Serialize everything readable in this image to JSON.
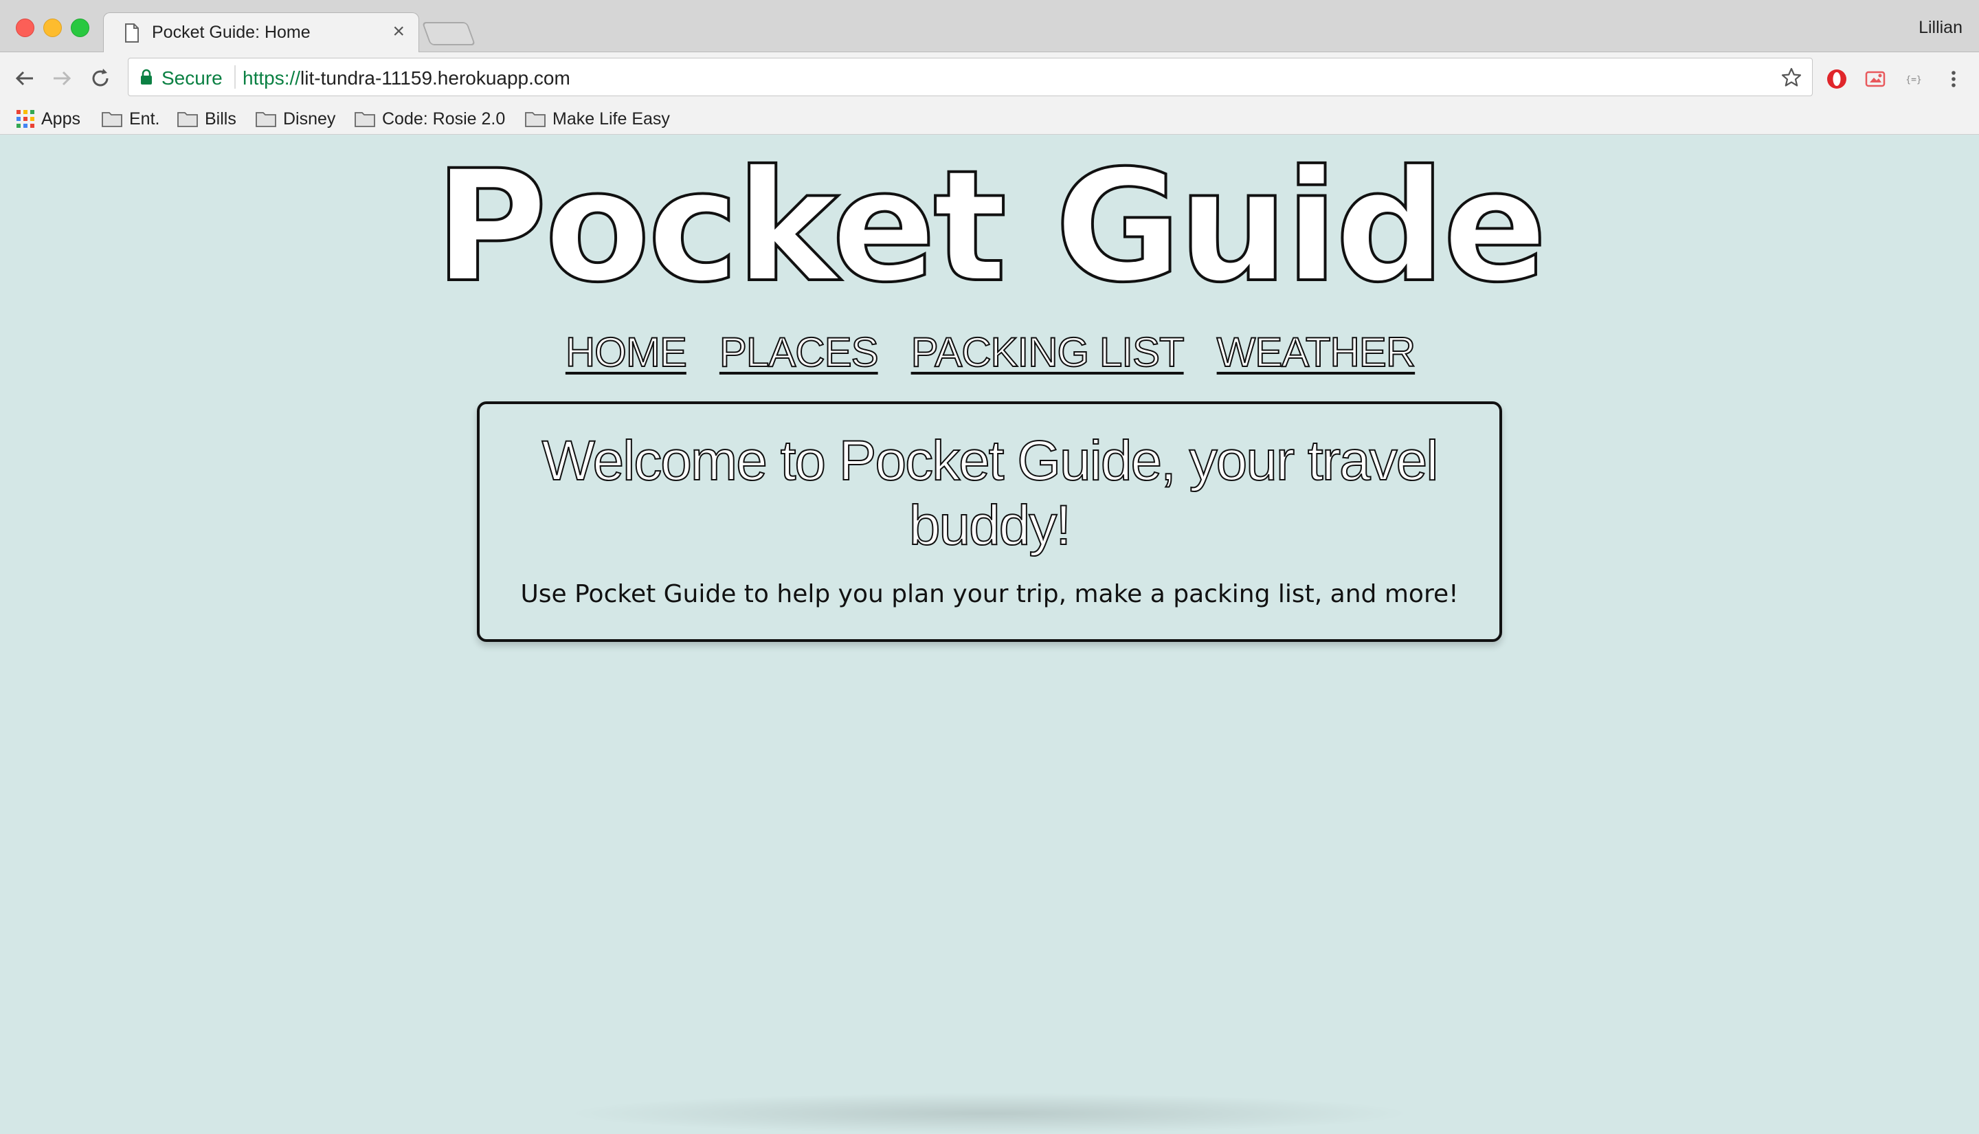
{
  "browser": {
    "tab_title": "Pocket Guide: Home",
    "tab_close": "×",
    "profile_name": "Lillian",
    "secure_label": "Secure",
    "url_scheme": "https://",
    "url_host": "lit-tundra-11159.herokuapp.com",
    "bookmarks": [
      {
        "label": "Apps",
        "icon": "apps-grid-icon"
      },
      {
        "label": "Ent.",
        "icon": "folder-icon"
      },
      {
        "label": "Bills",
        "icon": "folder-icon"
      },
      {
        "label": "Disney",
        "icon": "folder-icon"
      },
      {
        "label": "Code: Rosie 2.0",
        "icon": "folder-icon"
      },
      {
        "label": "Make Life Easy",
        "icon": "folder-icon"
      }
    ],
    "extensions": [
      "opera-icon",
      "screenshot-extension-icon",
      "json-viewer-icon"
    ]
  },
  "page": {
    "logo": "Pocket Guide",
    "nav": [
      "HOME",
      "PLACES",
      "PACKING LIST",
      "WEATHER"
    ],
    "welcome_heading": "Welcome to Pocket Guide, your travel buddy!",
    "welcome_sub": "Use Pocket Guide to help you plan your trip, make a packing list, and more!"
  },
  "colors": {
    "page_background": "#d4e7e6",
    "secure_green": "#0b8043"
  }
}
